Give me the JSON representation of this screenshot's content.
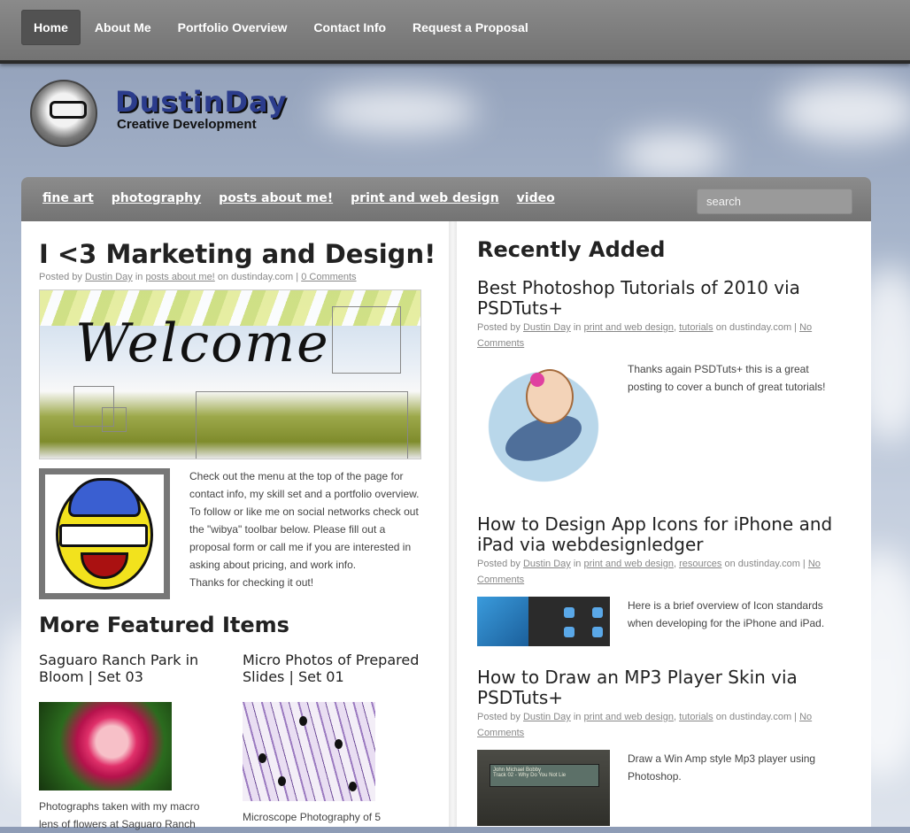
{
  "topnav": [
    "Home",
    "About Me",
    "Portfolio Overview",
    "Contact Info",
    "Request a Proposal"
  ],
  "logo": {
    "name": "DustinDay",
    "tagline": "Creative Development"
  },
  "categories": [
    "fine art",
    "photography",
    "posts about me!",
    "print and web design",
    "video"
  ],
  "search": {
    "placeholder": "search"
  },
  "post": {
    "title": "I <3 Marketing and Design!",
    "meta": {
      "prefix": "Posted by",
      "author": "Dustin Day",
      "in": "in",
      "category": "posts about me!",
      "site": "on dustinday.com |",
      "comments": "0 Comments"
    },
    "banner_word": "Welcome",
    "intro": [
      "Check out the menu at the top of the page for contact info, my skill set and a portfolio overview. To follow or like me on social networks check out the \"wibya\" toolbar below. Please fill out a proposal form or call me if you are interested in asking about pricing, and work info.",
      "Thanks for checking it out!"
    ]
  },
  "featured": {
    "heading": "More Featured Items",
    "items": [
      {
        "title": "Saguaro Ranch Park in Bloom | Set 03",
        "text": "Photographs taken with my macro lens of flowers at Saguaro Ranch"
      },
      {
        "title": "Micro Photos of Prepared Slides | Set 01",
        "text": "Microscope Photography of 5"
      }
    ]
  },
  "recent": {
    "heading": "Recently Added",
    "articles": [
      {
        "title": "Best Photoshop Tutorials of 2010 via PSDTuts+",
        "prefix": "Posted by",
        "author": "Dustin Day",
        "in": "in",
        "cat1": "print and web design",
        "sep": ",",
        "cat2": "tutorials",
        "site": "on dustinday.com |",
        "comments": "No Comments",
        "text": "Thanks again PSDTuts+ this is a great posting to cover a bunch of great tutorials!"
      },
      {
        "title": "How to Design App Icons for iPhone and iPad via webdesignledger",
        "prefix": "Posted by",
        "author": "Dustin Day",
        "in": "in",
        "cat1": "print and web design",
        "sep": ",",
        "cat2": "resources",
        "site": "on dustinday.com |",
        "comments": "No Comments",
        "text": "Here is a brief overview of Icon standards when developing for the iPhone and iPad."
      },
      {
        "title": "How to Draw an MP3 Player Skin via PSDTuts+",
        "prefix": "Posted by",
        "author": "Dustin Day",
        "in": "in",
        "cat1": "print and web design",
        "sep": ",",
        "cat2": "tutorials",
        "site": "on dustinday.com |",
        "comments": "No Comments",
        "text": "Draw a Win Amp style Mp3 player using Photoshop."
      }
    ]
  },
  "mp3_screen": {
    "line1": "John Michael Bobby",
    "line2": "Track 02 - Why Do You Not Lie"
  }
}
